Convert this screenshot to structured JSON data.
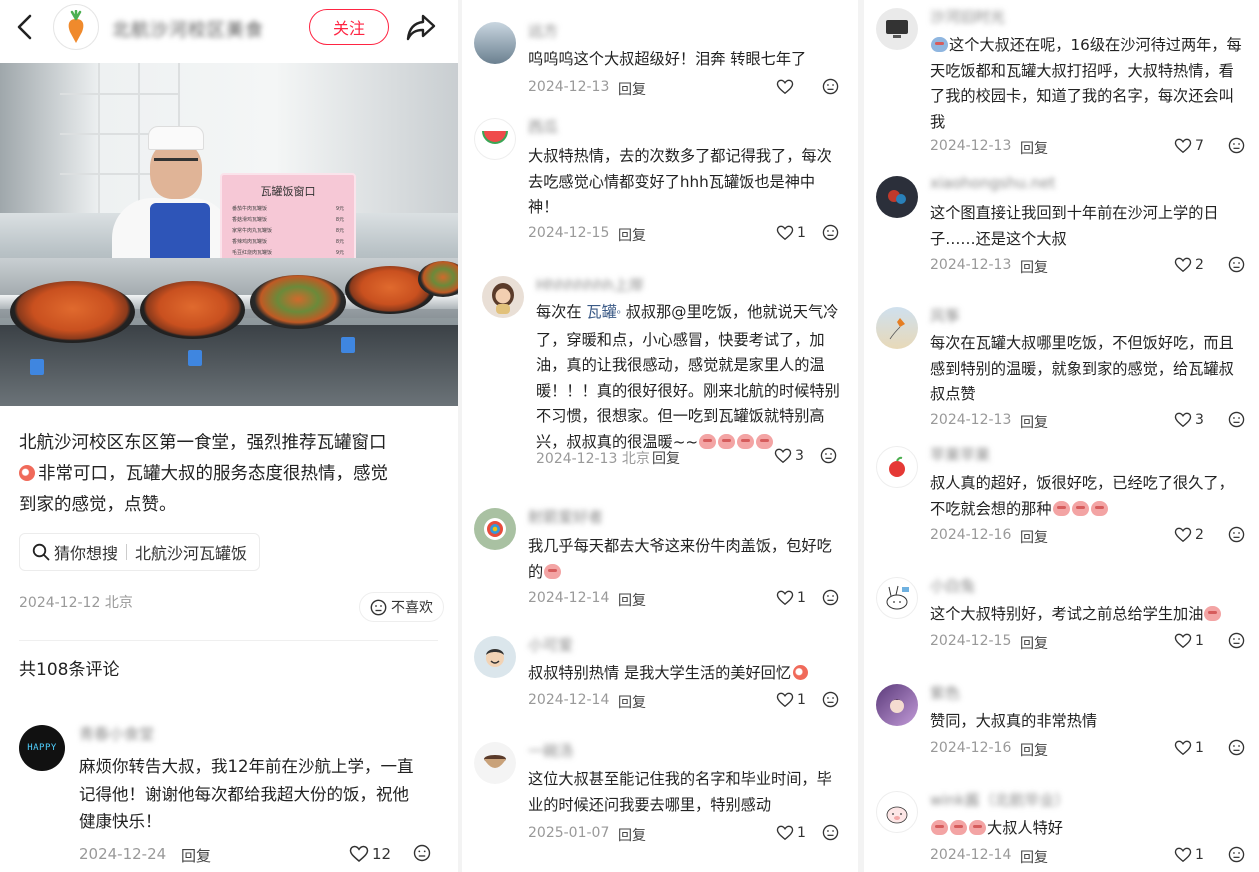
{
  "post": {
    "author": "北航沙河校区美食",
    "follow_label": "关注",
    "body_line1": "北航沙河校区东区第一食堂，强烈推荐瓦罐窗口",
    "body_line2": "非常可口，瓦罐大叔的服务态度很热情，感觉",
    "body_line3": "到家的感觉，点赞。",
    "search_prefix": "猜你想搜",
    "search_term": "北航沙河瓦罐饭",
    "date": "2024-12-12",
    "location": "北京",
    "dislike_label": "不喜欢",
    "comment_count": "共108条评论",
    "sign": {
      "title": "瓦罐饭窗口",
      "items": [
        {
          "name": "番茄牛肉瓦罐饭",
          "price": "9元"
        },
        {
          "name": "香菇滑鸡瓦罐饭",
          "price": "8元"
        },
        {
          "name": "家常牛肉丸瓦罐饭",
          "price": "8元"
        },
        {
          "name": "香辣鸡肉瓦罐饭",
          "price": "8元"
        },
        {
          "name": "毛豆红烧肉瓦罐饭",
          "price": "9元"
        }
      ]
    }
  },
  "reply_label": "回复",
  "comments_left": [
    {
      "name": "青春小食堂",
      "text1": "麻烦你转告大叔，我12年前在沙航上学，一直",
      "text2": "记得他！谢谢他每次都给我超大份的饭，祝他",
      "text3": "健康快乐！",
      "date": "2024-12-24",
      "likes": "12"
    }
  ],
  "comments_mid": [
    {
      "name": "远方",
      "text1": "呜呜呜这个大叔超级好！泪奔 转眼七年了",
      "text2": "",
      "text3": "",
      "date": "2024-12-13",
      "likes": ""
    },
    {
      "name": "西瓜",
      "text1": "大叔特热情，去的次数多了都记得我了，每次",
      "text2": "去吃感觉心情都变好了hhh瓦罐饭也是神中",
      "text3": "神！",
      "date": "2024-12-15",
      "likes": "1"
    },
    {
      "name": "Hhhhhhhh上岸",
      "text1": "每次在",
      "link": "瓦罐",
      "text1b": "叔叔那@里吃饭，他就说天气冷",
      "text2": "了，穿暖和点，小心感冒，快要考试了，加",
      "text3": "油，真的让我很感动，感觉就是家里人的温",
      "text4": "暖！！！真的很好很好。刚来北航的时候特别",
      "text5": "不习惯，很想家。但一吃到瓦罐饭就特别高",
      "text6": "兴，叔叔真的很温暖~~",
      "date": "2024-12-13",
      "location": "北京",
      "likes": "3"
    },
    {
      "name": "射箭爱好者",
      "text1": "我几乎每天都去大爷这来份牛肉盖饭，包好吃",
      "text2": "的",
      "date": "2024-12-14",
      "likes": "1"
    },
    {
      "name": "小可爱",
      "text1": "叔叔特别热情 是我大学生活的美好回忆",
      "date": "2024-12-14",
      "likes": "1"
    },
    {
      "name": "一碗汤",
      "text1": "这位大叔甚至能记住我的名字和毕业时间，毕",
      "text2": "业的时候还问我要去哪里，特别感动",
      "date": "2025-01-07",
      "likes": "1"
    }
  ],
  "comments_right": [
    {
      "name": "沙河旧时光",
      "text1": "这个大叔还在呢，16级在沙河待过两年，每",
      "text2": "天吃饭都和瓦罐大叔打招呼，大叔特热情，看",
      "text3": "了我的校园卡，知道了我的名字，每次还会叫",
      "text4": "我",
      "date": "2024-12-13",
      "likes": "7"
    },
    {
      "name": "xiaohongshu.net",
      "text1": "这个图直接让我回到十年前在沙河上学的日",
      "text2": "子……还是这个大叔",
      "date": "2024-12-13",
      "likes": "2"
    },
    {
      "name": "风筝",
      "text1": "每次在瓦罐大叔哪里吃饭，不但饭好吃，而且",
      "text2": "感到特别的温暖，就象到家的感觉，给瓦罐叔",
      "text3": "叔点赞",
      "date": "2024-12-13",
      "likes": "3"
    },
    {
      "name": "苹果苹果",
      "text1": "叔人真的超好，饭很好吃，已经吃了很久了，",
      "text2": "不吃就会想的那种",
      "date": "2024-12-16",
      "likes": "2"
    },
    {
      "name": "小白兔",
      "text1": "这个大叔特别好，考试之前总给学生加油",
      "date": "2024-12-15",
      "likes": "1"
    },
    {
      "name": "紫色",
      "text1": "赞同，大叔真的非常热情",
      "date": "2024-12-16",
      "likes": "1"
    },
    {
      "name": "wink酱（北航毕业）",
      "text1": "大叔人特好",
      "date": "2024-12-14",
      "likes": "1"
    }
  ]
}
